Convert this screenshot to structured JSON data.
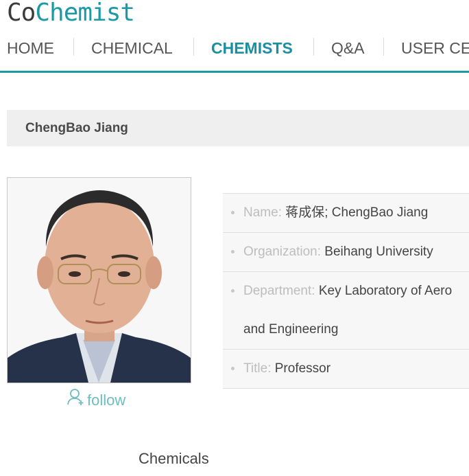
{
  "logo": {
    "part1": "Co",
    "part2": "Chemist"
  },
  "nav": {
    "items": [
      {
        "label": "HOME",
        "active": false
      },
      {
        "label": "CHEMICAL",
        "active": false
      },
      {
        "label": "CHEMISTS",
        "active": true
      },
      {
        "label": "Q&A",
        "active": false
      },
      {
        "label": "USER CE",
        "active": false
      }
    ]
  },
  "profile": {
    "name": "ChengBao Jiang",
    "follow_label": "follow",
    "fields": {
      "name_label": "Name:",
      "name_value": "蒋成保; ChengBao Jiang",
      "org_label": "Organization:",
      "org_value": "Beihang University",
      "dept_label": "Department:",
      "dept_value_line1": "Key Laboratory of Aero",
      "dept_value_line2": "and Engineering",
      "title_label": "Title:",
      "title_value": "Professor"
    }
  },
  "sections": {
    "chemicals": "Chemicals"
  },
  "colors": {
    "accent": "#1a9aa6",
    "follow": "#6fbcc0",
    "label_gray": "#bdbdbd"
  }
}
